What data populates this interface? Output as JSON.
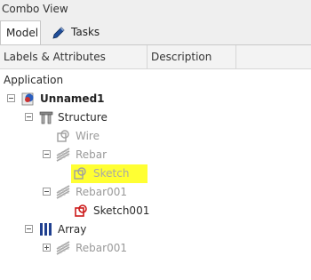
{
  "panel": {
    "title": "Combo View"
  },
  "tabs": [
    {
      "label": "Model",
      "active": true
    },
    {
      "label": "Tasks",
      "active": false
    }
  ],
  "header": {
    "col1": "Labels & Attributes",
    "col2": "Description"
  },
  "tree": {
    "root": "Application",
    "items": [
      {
        "label": "Unnamed1",
        "icon": "document-icon",
        "expander": "minus"
      },
      {
        "label": "Structure",
        "icon": "structure-icon",
        "expander": "minus"
      },
      {
        "label": "Wire",
        "icon": "wire-icon",
        "hidden": true
      },
      {
        "label": "Rebar",
        "icon": "rebar-icon",
        "expander": "minus",
        "hidden": true
      },
      {
        "label": "Sketch",
        "icon": "sketch-icon",
        "hidden": true,
        "highlighted": true
      },
      {
        "label": "Rebar001",
        "icon": "rebar-icon",
        "expander": "minus",
        "hidden": true
      },
      {
        "label": "Sketch001",
        "icon": "sketch-icon"
      },
      {
        "label": "Array",
        "icon": "array-icon",
        "expander": "minus"
      },
      {
        "label": "Rebar001",
        "icon": "rebar-icon",
        "expander": "plus",
        "hidden": true
      }
    ]
  },
  "colors": {
    "highlight": "#ffff33",
    "sketch_red": "#cc1a1a",
    "hidden_text": "#9a9a9a"
  }
}
